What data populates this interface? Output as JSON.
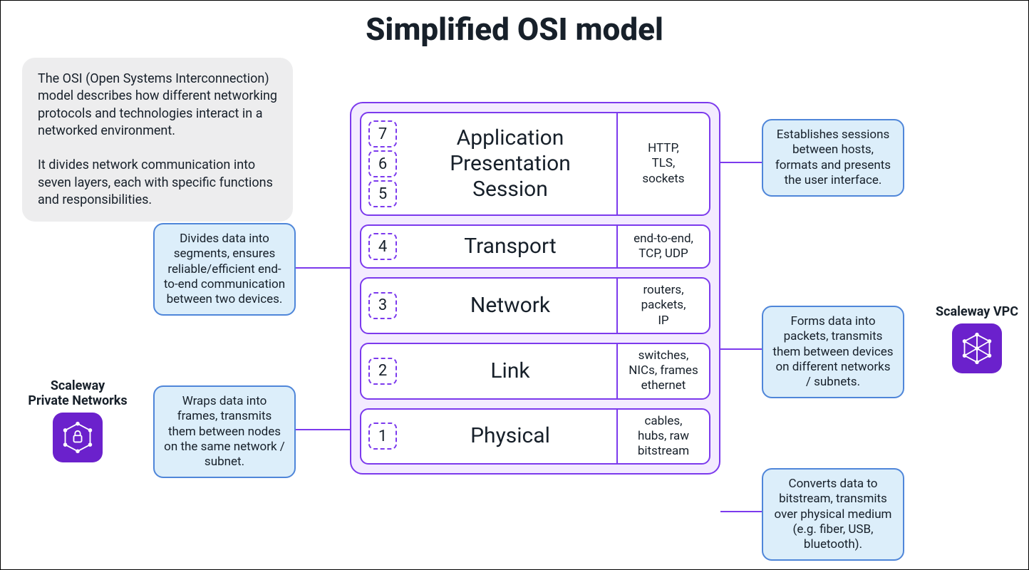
{
  "title": "Simplified OSI model",
  "intro": "The OSI (Open Systems Interconnection) model describes how different networking protocols and technologies interact in a networked environment.\n\nIt divides network communication into seven layers, each with specific functions and responsibilities.",
  "layers": [
    {
      "numbers": [
        "7",
        "6",
        "5"
      ],
      "name": "Application\nPresentation\nSession",
      "proto": "HTTP,\nTLS,\nsockets"
    },
    {
      "numbers": [
        "4"
      ],
      "name": "Transport",
      "proto": "end-to-end,\nTCP, UDP"
    },
    {
      "numbers": [
        "3"
      ],
      "name": "Network",
      "proto": "routers,\npackets,\nIP"
    },
    {
      "numbers": [
        "2"
      ],
      "name": "Link",
      "proto": "switches,\nNICs, frames\nethernet"
    },
    {
      "numbers": [
        "1"
      ],
      "name": "Physical",
      "proto": "cables,\nhubs, raw\nbitstream"
    }
  ],
  "notes": {
    "app": "Establishes sessions between hosts, formats and presents the user interface.",
    "transport": "Divides data into segments, ensures reliable/efficient end-to-end communication between two devices.",
    "network": "Forms data into packets, transmits them between devices on different networks / subnets.",
    "link": "Wraps data into frames, transmits them between nodes on the same network / subnet.",
    "physical": "Converts data to bitstream, transmits over physical medium (e.g. fiber, USB, bluetooth)."
  },
  "badges": {
    "pn": "Scaleway\nPrivate Networks",
    "vpc": "Scaleway VPC"
  }
}
